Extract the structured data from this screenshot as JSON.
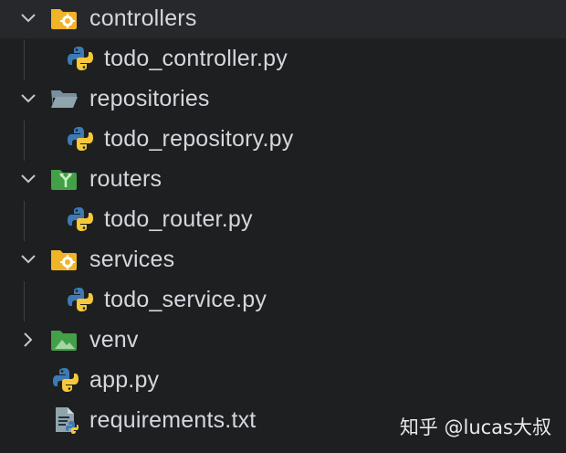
{
  "tree": [
    {
      "label": "controllers",
      "icon": "folder-settings-icon",
      "expanded": true
    },
    {
      "label": "todo_controller.py",
      "icon": "python-file-icon"
    },
    {
      "label": "repositories",
      "icon": "folder-open-icon",
      "expanded": true
    },
    {
      "label": "todo_repository.py",
      "icon": "python-file-icon"
    },
    {
      "label": "routers",
      "icon": "folder-routes-icon",
      "expanded": true
    },
    {
      "label": "todo_router.py",
      "icon": "python-file-icon"
    },
    {
      "label": "services",
      "icon": "folder-settings-icon",
      "expanded": true
    },
    {
      "label": "todo_service.py",
      "icon": "python-file-icon"
    },
    {
      "label": "venv",
      "icon": "folder-environment-icon",
      "expanded": false
    },
    {
      "label": "app.py",
      "icon": "python-file-icon"
    },
    {
      "label": "requirements.txt",
      "icon": "text-file-icon"
    }
  ],
  "watermark": "知乎 @lucas大叔",
  "colors": {
    "background": "#1e1f21",
    "selected_row": "#26282b",
    "text": "#d4d7dd",
    "folder_yellow": "#f0b429",
    "folder_gray": "#90a4ae",
    "folder_green": "#43a047",
    "python_blue": "#3d7ab5",
    "python_yellow": "#f5c93a"
  }
}
